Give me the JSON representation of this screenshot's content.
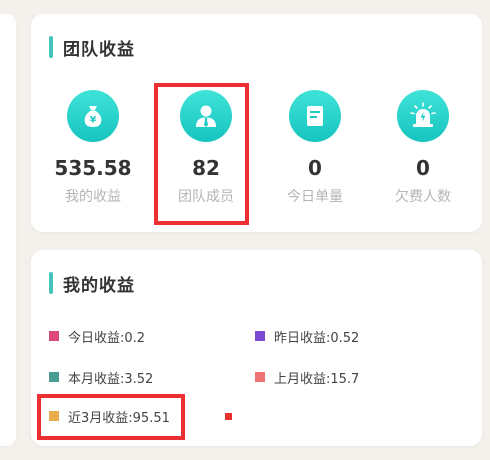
{
  "team_earnings": {
    "title": "团队收益",
    "stats": [
      {
        "icon": "money-bag-icon",
        "value": "535.58",
        "label": "我的收益"
      },
      {
        "icon": "team-member-icon",
        "value": "82",
        "label": "团队成员"
      },
      {
        "icon": "document-icon",
        "value": "0",
        "label": "今日单量"
      },
      {
        "icon": "alarm-light-icon",
        "value": "0",
        "label": "欠费人数"
      }
    ]
  },
  "my_earnings": {
    "title": "我的收益",
    "legend": [
      {
        "label": "今日收益:0.2",
        "color": "#dd4a7a"
      },
      {
        "label": "昨日收益:0.52",
        "color": "#7c4ad2"
      },
      {
        "label": "本月收益:3.52",
        "color": "#4a9d93"
      },
      {
        "label": "上月收益:15.7",
        "color": "#f07373"
      },
      {
        "label": "近3月收益:95.51",
        "color": "#e8ad48"
      }
    ]
  },
  "colors": {
    "accent": "#43c6b7",
    "icon_gradient_top": "#3fe3d8",
    "icon_gradient_bottom": "#17c4bf",
    "highlight": "#ec2f33",
    "stray_marker": "#e5322d"
  }
}
